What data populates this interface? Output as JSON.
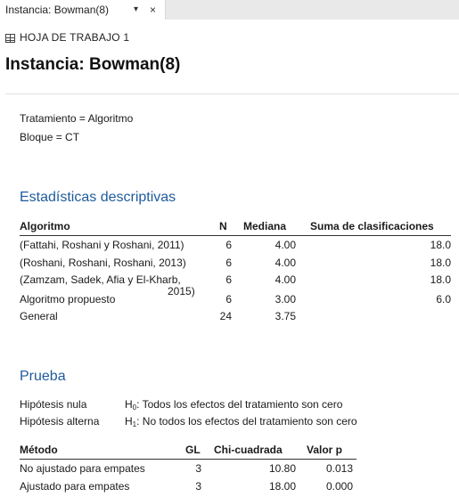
{
  "tab": {
    "title": "Instancia: Bowman(8)",
    "chevron": "▾",
    "close": "×"
  },
  "worksheet": {
    "icon": "grid-icon",
    "label": "HOJA DE TRABAJO 1"
  },
  "page_title": "Instancia: Bowman(8)",
  "setup": {
    "tratamiento": "Tratamiento = Algoritmo",
    "bloque": "Bloque = CT"
  },
  "descriptive": {
    "heading": "Estadísticas descriptivas",
    "headers": {
      "algoritmo": "Algoritmo",
      "n": "N",
      "mediana": "Mediana",
      "suma": "Suma de clasificaciones"
    },
    "rows": [
      {
        "algoritmo": "(Fattahi, Roshani y Roshani, 2011)",
        "n": "6",
        "mediana": "4.00",
        "suma": "18.0"
      },
      {
        "algoritmo": "(Roshani, Roshani, Roshani, 2013)",
        "n": "6",
        "mediana": "4.00",
        "suma": "18.0"
      },
      {
        "algoritmo": "(Zamzam, Sadek, Afia y El-Kharb,",
        "algoritmo_cont": "2015)",
        "n": "6",
        "mediana": "4.00",
        "suma": "18.0"
      },
      {
        "algoritmo": "Algoritmo propuesto",
        "n": "6",
        "mediana": "3.00",
        "suma": "6.0"
      },
      {
        "algoritmo": "General",
        "n": "24",
        "mediana": "3.75",
        "suma": ""
      }
    ]
  },
  "test": {
    "heading": "Prueba",
    "null_label": "Hipótesis nula",
    "null_symbol": "H",
    "null_sub": "0",
    "null_text": ": Todos los efectos del tratamiento son cero",
    "alt_label": "Hipótesis alterna",
    "alt_symbol": "H",
    "alt_sub": "1",
    "alt_text": ": No todos los efectos del tratamiento son cero",
    "headers": {
      "metodo": "Método",
      "gl": "GL",
      "chi": "Chi-cuadrada",
      "p": "Valor p"
    },
    "rows": [
      {
        "metodo": "No ajustado para empates",
        "gl": "3",
        "chi": "10.80",
        "p": "0.013"
      },
      {
        "metodo": "Ajustado para empates",
        "gl": "3",
        "chi": "18.00",
        "p": "0.000"
      }
    ]
  }
}
